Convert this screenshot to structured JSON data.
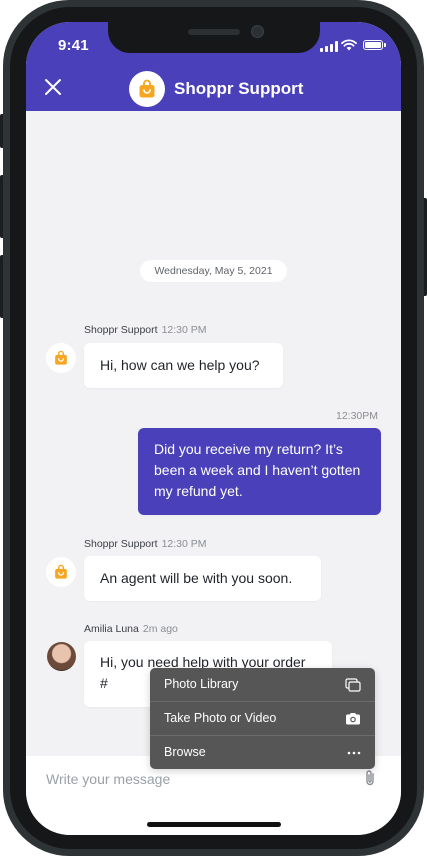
{
  "status_bar": {
    "time": "9:41"
  },
  "header": {
    "title": "Shoppr Support",
    "accent_color": "#4a40b9",
    "logo_color": "#f5a623"
  },
  "chat": {
    "date_divider": "Wednesday, May 5, 2021",
    "messages": [
      {
        "sender": "Shoppr Support",
        "time": "12:30 PM",
        "text": "Hi, how can we help you?"
      },
      {
        "sender": "",
        "time": "12:30PM",
        "text": "Did you receive my return? It’s been a week and I haven’t gotten my refund yet."
      },
      {
        "sender": "Shoppr Support",
        "time": "12:30 PM",
        "text": "An agent will be with you soon."
      },
      {
        "sender": "Amilia Luna",
        "time": "2m ago",
        "text": "Hi, you need help with your order #"
      }
    ]
  },
  "attachment_menu": {
    "items": [
      {
        "label": "Photo Library",
        "icon": "photo-library-icon"
      },
      {
        "label": "Take Photo or Video",
        "icon": "camera-icon"
      },
      {
        "label": "Browse",
        "icon": "more-icon"
      }
    ]
  },
  "composer": {
    "placeholder": "Write your message",
    "attach_icon": "paperclip-icon"
  }
}
